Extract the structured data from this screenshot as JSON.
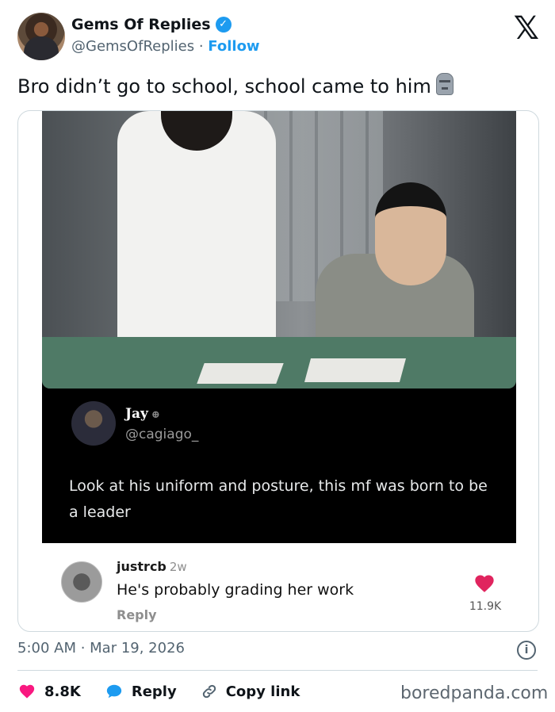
{
  "author": {
    "name": "Gems Of Replies",
    "handle": "@GemsOfReplies",
    "separator": "·",
    "follow_label": "Follow",
    "verified_glyph": "✓"
  },
  "platform_logo": "𝕏",
  "tweet_text": "Bro didn’t go to school, school came to him",
  "embedded_post": {
    "name": "Jay",
    "handle": "@cagiago_",
    "text": "Look at his uniform and posture, this mf was born to be a leader"
  },
  "comment": {
    "user": "justrcb",
    "age": "2w",
    "text": "He's probably grading her work",
    "reply_label": "Reply",
    "likes": "11.9K",
    "heart_color": "#e0245e"
  },
  "timestamp": "5:00 AM · Mar 19, 2026",
  "info_glyph": "i",
  "actions": {
    "like_count": "8.8K",
    "reply_label": "Reply",
    "copy_label": "Copy link"
  },
  "watermark": "boredpanda.com",
  "colors": {
    "accent": "#1d9bf0",
    "like": "#f91880"
  }
}
